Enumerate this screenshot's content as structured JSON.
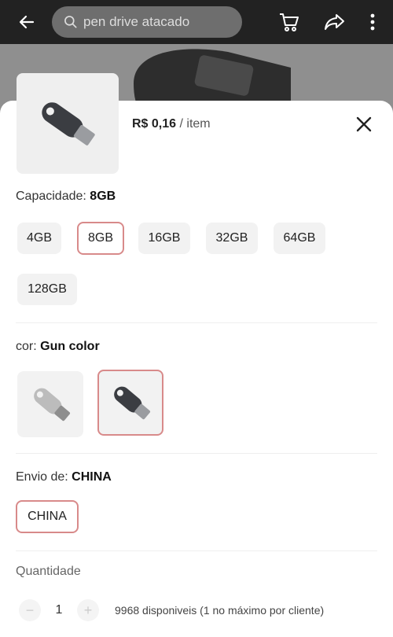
{
  "topbar": {
    "search_placeholder": "pen drive atacado",
    "back_icon": "arrow-left-icon",
    "cart_icon": "cart-icon",
    "share_icon": "share-icon",
    "more_icon": "more-vertical-icon"
  },
  "sheet": {
    "price": "R$ 0,16",
    "price_unit": "/ item",
    "close_icon": "close-icon"
  },
  "capacity": {
    "label": "Capacidade:",
    "selected": "8GB",
    "options": [
      "4GB",
      "8GB",
      "16GB",
      "32GB",
      "64GB",
      "128GB"
    ]
  },
  "color": {
    "label": "cor:",
    "selected": "Gun color"
  },
  "shipping": {
    "label": "Envio de:",
    "selected": "CHINA",
    "options": [
      "CHINA"
    ]
  },
  "quantity": {
    "label": "Quantidade",
    "value": "1",
    "minus": "−",
    "plus": "+",
    "stock_text": "9968 disponiveis (1 no máximo por cliente)"
  },
  "colors": {
    "accent": "#d88a8a",
    "sheet_bg": "#ffffff",
    "chip_bg": "#f2f2f2"
  }
}
